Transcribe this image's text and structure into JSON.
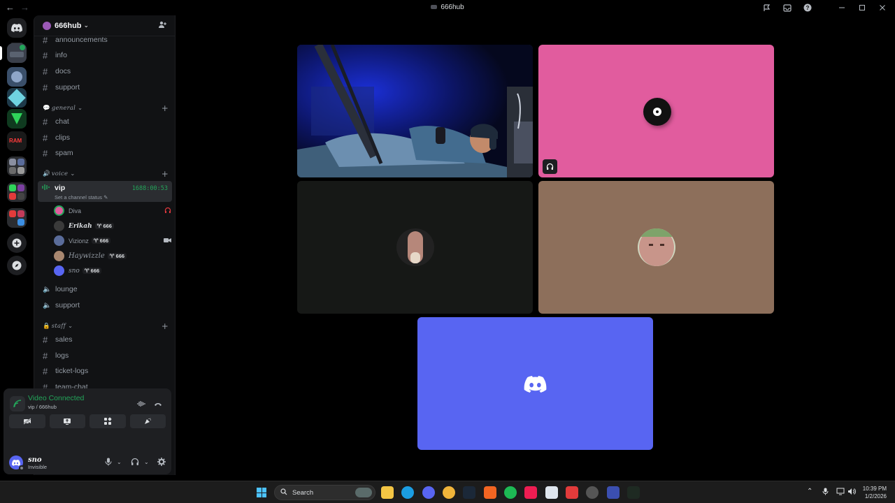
{
  "window": {
    "title": "666hub",
    "nav_back": "←",
    "nav_forward": "→"
  },
  "server": {
    "name": "666hub"
  },
  "channels": {
    "top": [
      "announcements",
      "info",
      "docs",
      "support"
    ],
    "categories": {
      "general": "general",
      "voice": "voice",
      "staff": "staff"
    },
    "general": [
      "chat",
      "clips",
      "spam"
    ],
    "vip": {
      "name": "vip",
      "timer": "1688:00:53",
      "status_placeholder": "Set a channel status"
    },
    "members": [
      {
        "name": "Diva",
        "tag": ""
      },
      {
        "name": "Erikah",
        "tag": "666"
      },
      {
        "name": "Vizionz",
        "tag": "666"
      },
      {
        "name": "Haywizzle",
        "tag": "666"
      },
      {
        "name": "sno",
        "tag": "666"
      }
    ],
    "voice_other": [
      "lounge",
      "support"
    ],
    "staff": [
      "sales",
      "logs",
      "ticket-logs",
      "team-chat"
    ]
  },
  "voice_panel": {
    "title": "Video Connected",
    "subtitle": "vip / 666hub"
  },
  "user": {
    "name": "sno",
    "status": "Invisible"
  },
  "taskbar": {
    "search": "Search",
    "time": "10:39 PM",
    "date": "1/2/2026"
  },
  "colors": {
    "green": "#23a55a",
    "blurple": "#5865f2",
    "pink_tile": "#e15c9e",
    "brown_tile": "#8d6f5b"
  }
}
